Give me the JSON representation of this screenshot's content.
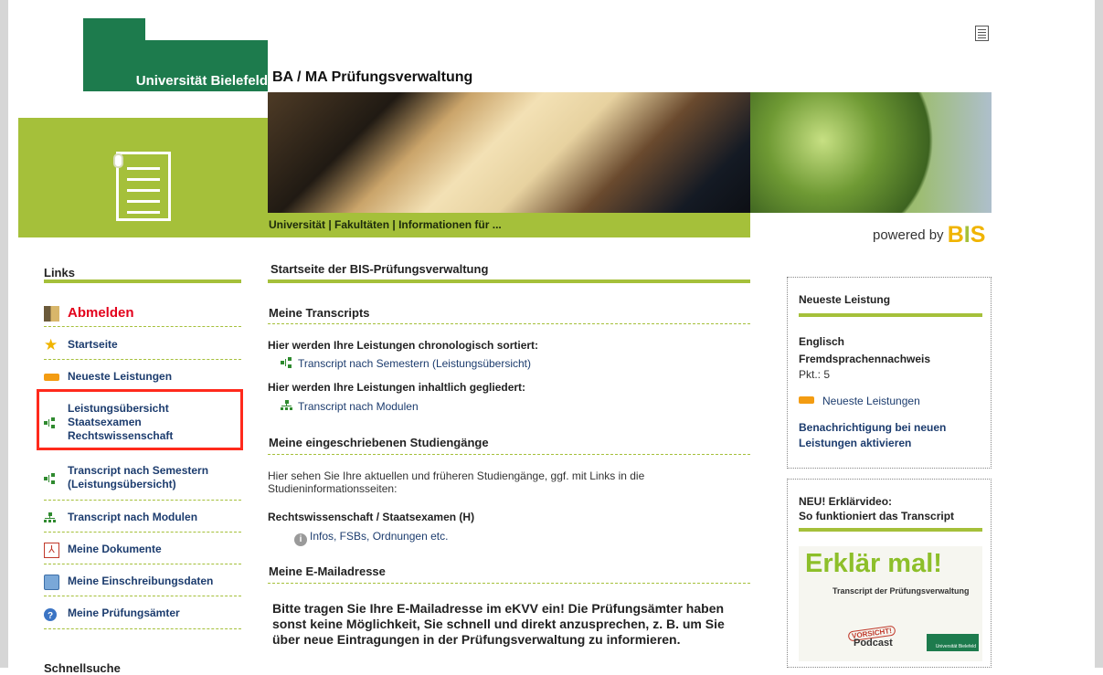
{
  "header": {
    "logo_text": "Universität Bielefeld",
    "app_title": "BA / MA Prüfungsverwaltung",
    "nav_strip": "Universität | Fakultäten | Informationen für ...",
    "powered_by": "powered by",
    "bis_logo": "BIS"
  },
  "sidebar": {
    "heading": "Links",
    "items": [
      {
        "label": "Abmelden",
        "icon": "door-icon"
      },
      {
        "label": "Startseite",
        "icon": "star-icon"
      },
      {
        "label": "Neueste Leistungen",
        "icon": "new-badge-icon"
      },
      {
        "label": "Leistungsübersicht Staatsexamen Rechtswissenschaft",
        "line1": "Leistungsübersicht",
        "line2": "Staatsexamen",
        "line3": "Rechtswissenschaft",
        "icon": "tree-icon"
      },
      {
        "label": "Transcript nach Semestern (Leistungsübersicht)",
        "line1": "Transcript nach Semestern",
        "line2": "(Leistungsübersicht)",
        "icon": "tree-icon"
      },
      {
        "label": "Transcript nach Modulen",
        "icon": "org-tree-icon"
      },
      {
        "label": "Meine Dokumente",
        "icon": "pdf-icon"
      },
      {
        "label": "Meine Einschreibungsdaten",
        "icon": "edit-document-icon"
      },
      {
        "label": "Meine Prüfungsämter",
        "icon": "help-circle-icon"
      }
    ],
    "quicksearch_heading": "Schnellsuche"
  },
  "main": {
    "page_title": "Startseite der BIS-Prüfungsverwaltung",
    "transcripts": {
      "heading": "Meine Transcripts",
      "chrono_text": "Hier werden Ihre Leistungen chronologisch sortiert:",
      "chrono_link": "Transcript nach Semestern (Leistungsübersicht)",
      "content_text": "Hier werden Ihre Leistungen inhaltlich gegliedert:",
      "content_link": "Transcript nach Modulen"
    },
    "programs": {
      "heading": "Meine eingeschriebenen Studiengänge",
      "desc_line1": "Hier sehen Sie Ihre aktuellen und früheren Studiengänge, ggf. mit Links in die",
      "desc_line2": "Studieninformationsseiten:",
      "program": "Rechtswissenschaft / Staatsexamen (H)",
      "info_link": "Infos, FSBs, Ordnungen etc."
    },
    "email": {
      "heading": "Meine E-Mailadresse",
      "notice": "Bitte tragen Sie Ihre E-Mailadresse im eKVV ein! Die Prüfungsämter haben sonst keine Möglichkeit, Sie schnell und direkt anzusprechen, z. B. um Sie über neue Eintragungen in der Prüfungsverwaltung zu informieren."
    }
  },
  "right_panel": {
    "latest": {
      "heading": "Neueste Leistung",
      "subject": "Englisch",
      "type": "Fremdsprachennachweis",
      "points": "Pkt.: 5",
      "link": "Neueste Leistungen",
      "notify_line1": "Benachrichtigung bei neuen",
      "notify_line2": "Leistungen aktivieren"
    },
    "video": {
      "heading_line1": "NEU! Erklärvideo:",
      "heading_line2": "So funktioniert das Transcript",
      "title": "Erklär mal!",
      "subtitle": "Transcript der Prüfungsverwaltung",
      "stamp": "VORSICHT!",
      "podcast": "Podcast",
      "uni": "Universität Bielefeld"
    }
  },
  "colors": {
    "accent_green": "#a5c03a",
    "uni_green": "#1d7b4d",
    "link_blue": "#1c3c6e",
    "logout_red": "#e3001b",
    "highlight_red": "#ff2a1c"
  }
}
